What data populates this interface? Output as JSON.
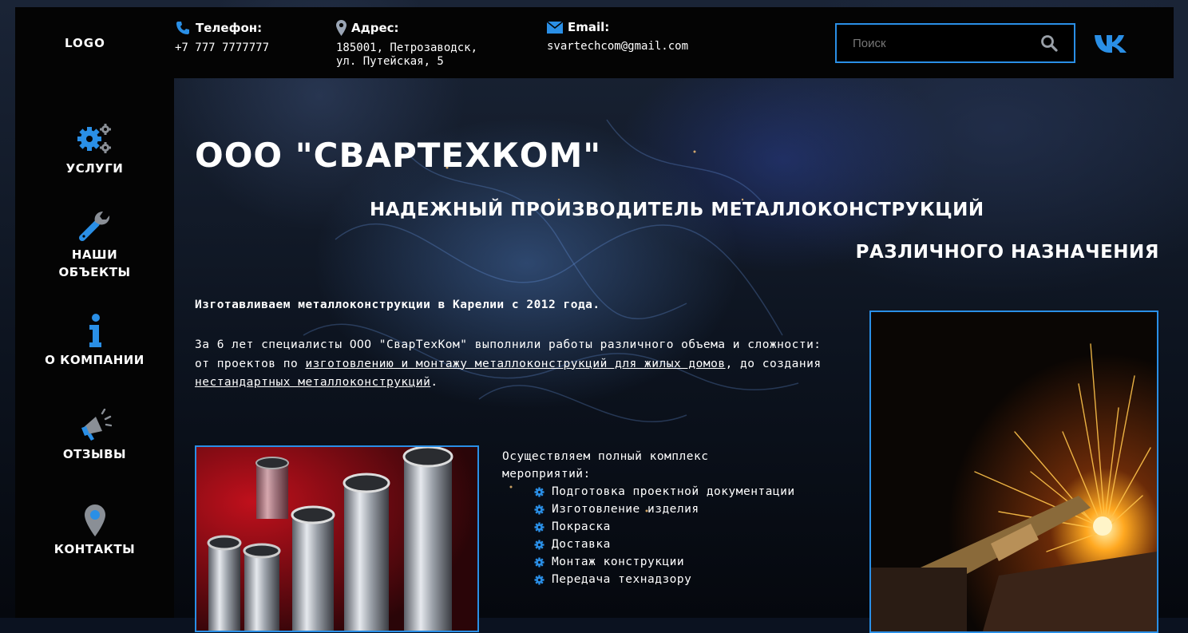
{
  "colors": {
    "accent": "#2a8fe6",
    "header_bg": "#040404"
  },
  "header": {
    "logo": "LOGO",
    "phone": {
      "label": "Телефон:",
      "value": "+7 777 7777777",
      "icon": "phone-icon"
    },
    "address": {
      "label": "Адрес:",
      "value": "185001, Петрозаводск,\nул. Путейская, 5",
      "icon": "map-pin-icon"
    },
    "email": {
      "label": "Email:",
      "value": "svartechcom@gmail.com",
      "icon": "envelope-icon"
    },
    "search": {
      "placeholder": "Поиск",
      "value": ""
    },
    "social": "vk-icon"
  },
  "sidebar": {
    "items": [
      {
        "label": "УСЛУГИ",
        "icon": "gears-icon"
      },
      {
        "label": "НАШИ\nОБЪЕКТЫ",
        "icon": "wrench-icon"
      },
      {
        "label": "О КОМПАНИИ",
        "icon": "info-icon"
      },
      {
        "label": "ОТЗЫВЫ",
        "icon": "megaphone-icon"
      },
      {
        "label": "КОНТАКТЫ",
        "icon": "map-pin-icon"
      }
    ]
  },
  "main": {
    "title": "ООО \"СВАРТЕХКОМ\"",
    "subtitle_line1": "НАДЕЖНЫЙ ПРОИЗВОДИТЕЛЬ МЕТАЛЛОКОНСТРУКЦИЙ",
    "subtitle_line2": "РАЗЛИЧНОГО НАЗНАЧЕНИЯ",
    "intro1": "Изготавливаем металлоконструкции в Карелии с 2012 года.",
    "intro2": {
      "part1": "За 6 лет специалисты ООО \"СварТехКом\" выполнили работы различного объема и сложности: от проектов по ",
      "link1": "изготовлению и монтажу металлоконструкций для жилых домов",
      "part2": ", до создания ",
      "link2": "нестандартных металлоконструкций",
      "part3": "."
    },
    "services": {
      "lead": "Осуществляем полный комплекс\nмероприятий:",
      "items": [
        "Подготовка проектной документации",
        "Изготовление изделия",
        "Покраска",
        "Доставка",
        "Монтаж конструкции",
        "Передача технадзору"
      ]
    }
  }
}
